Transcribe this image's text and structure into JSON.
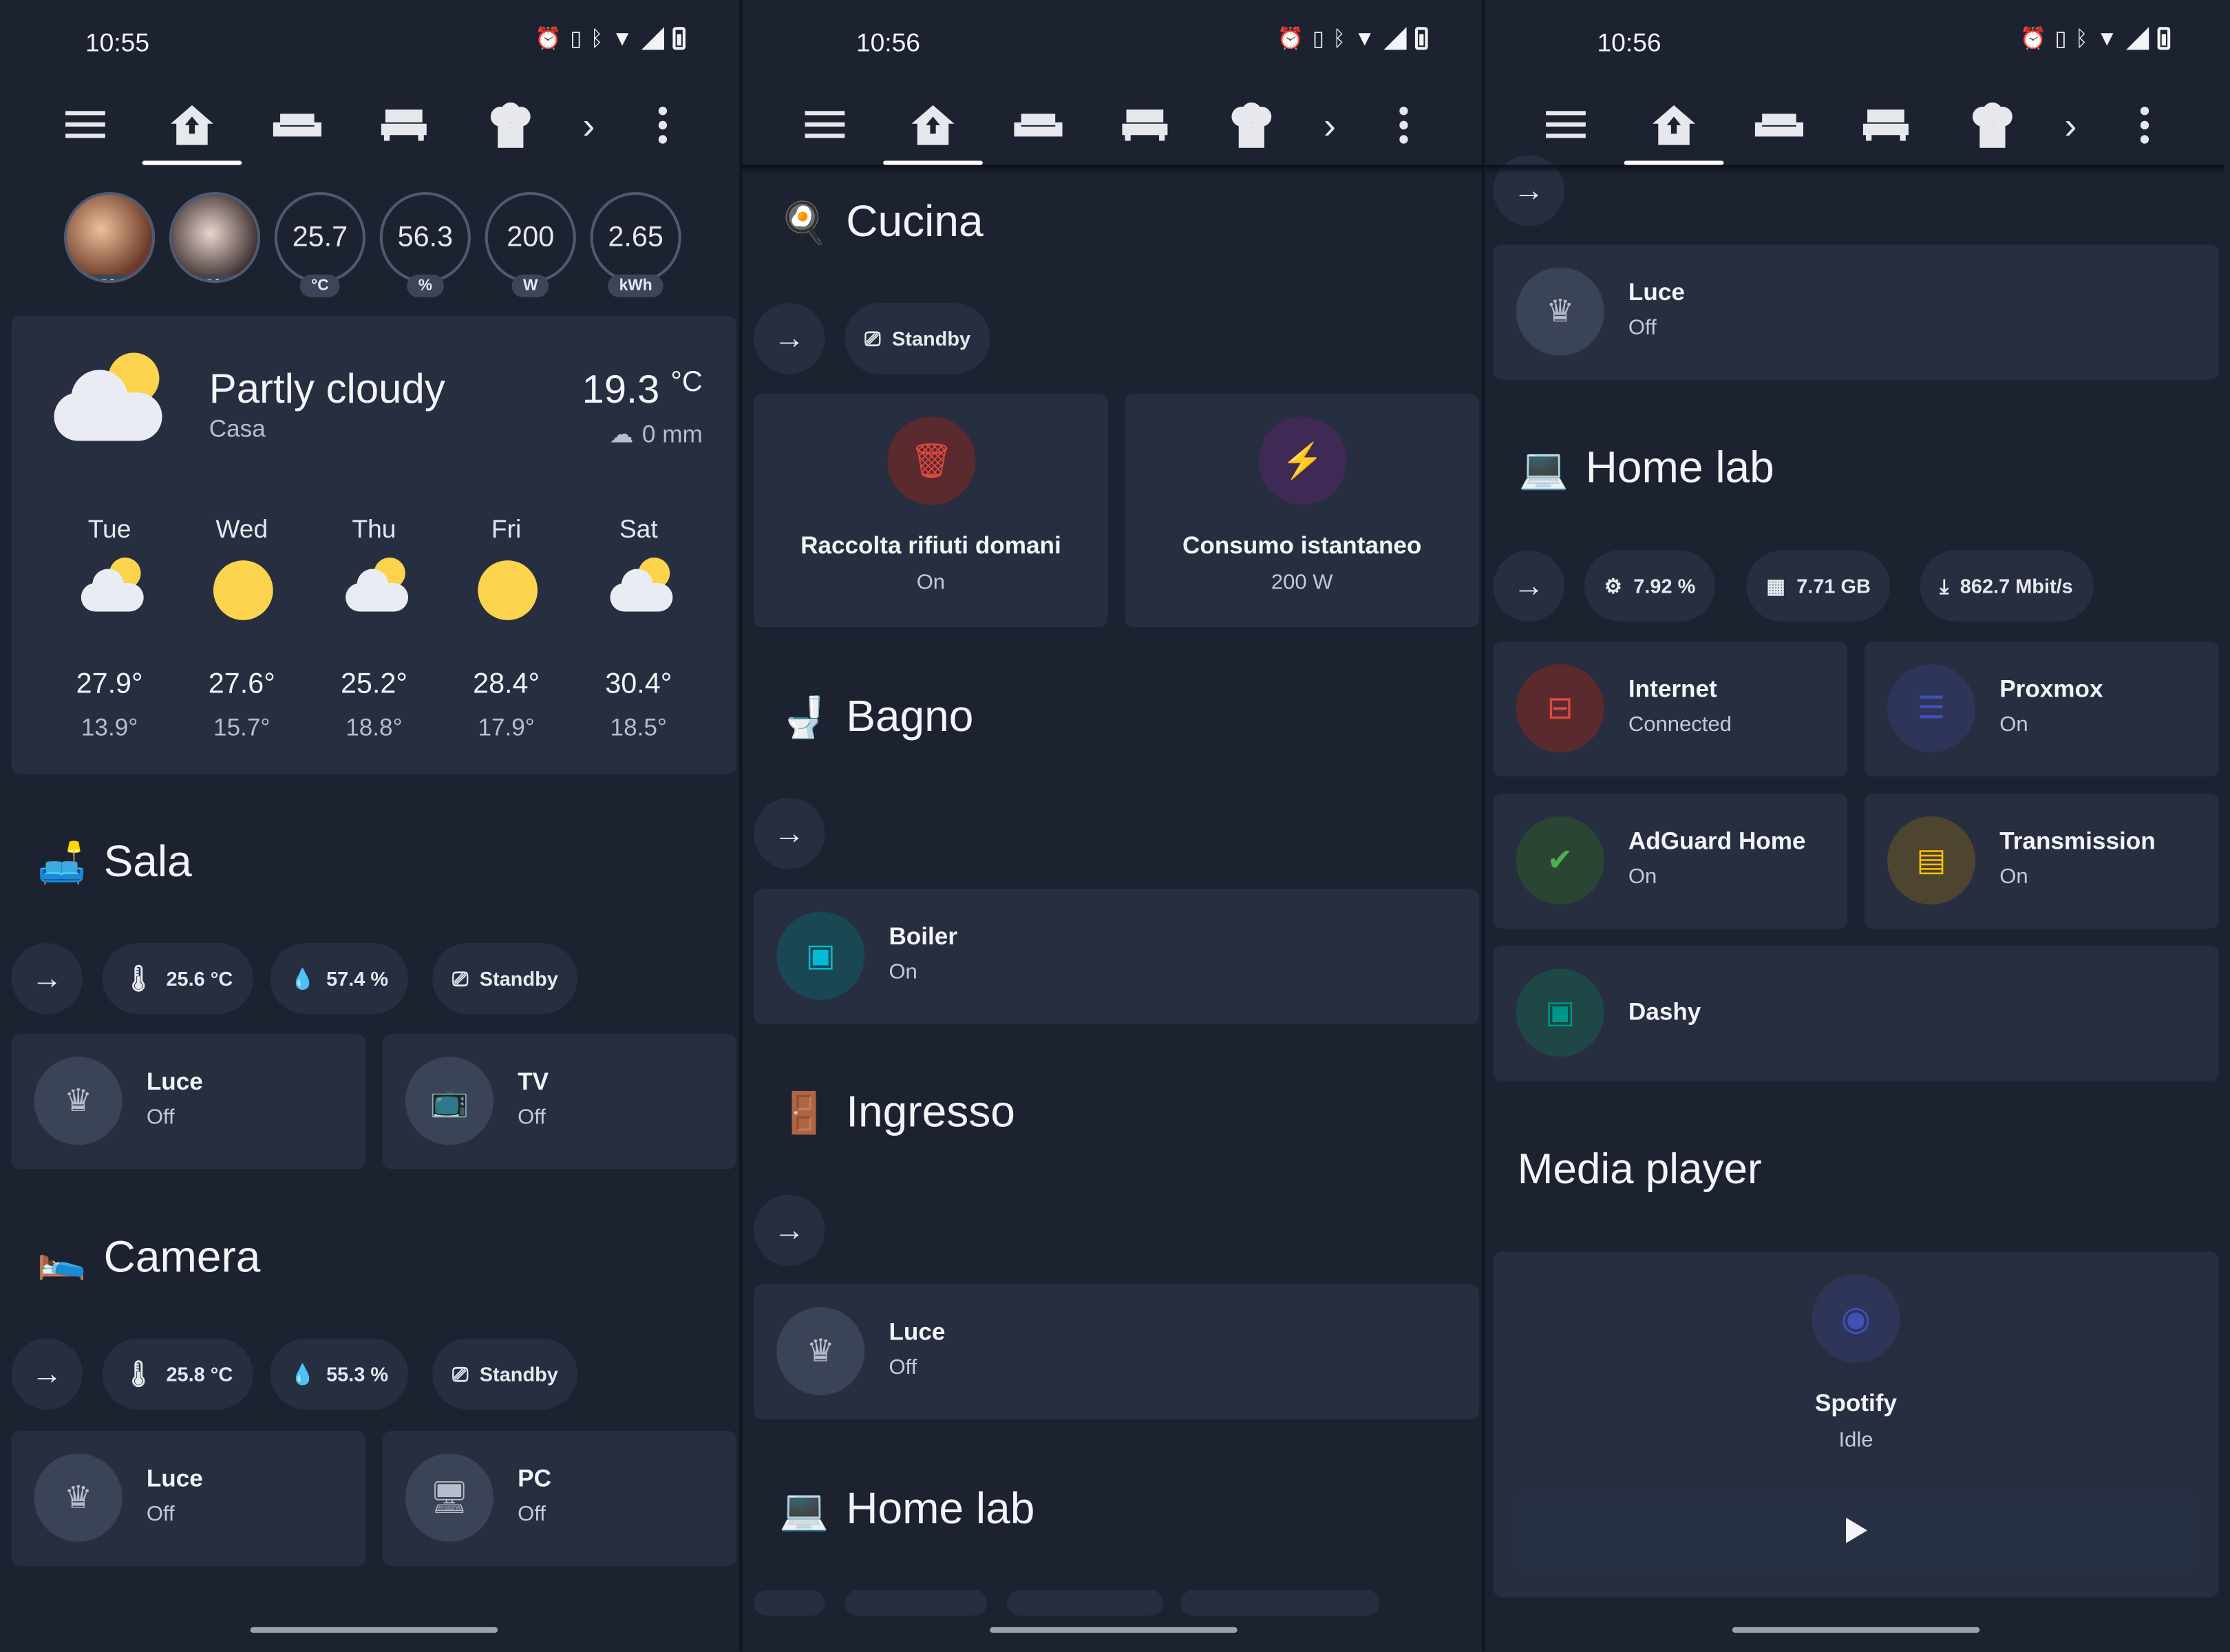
{
  "panels": [
    {
      "time": "10:55"
    },
    {
      "time": "10:56"
    },
    {
      "time": "10:56"
    }
  ],
  "status_icons": [
    "alarm-icon",
    "vibrate-icon",
    "bluetooth-icon",
    "wifi-icon",
    "signal-icon",
    "battery-icon"
  ],
  "toolbar": {
    "icons": [
      "menu-icon",
      "home-automation-icon",
      "sofa-icon",
      "bed-icon",
      "chef-hat-icon",
      "chevron-right-icon",
      "more-vertical-icon"
    ]
  },
  "badges": [
    {
      "value": "",
      "label": "HOME"
    },
    {
      "value": "",
      "label": "HOME"
    },
    {
      "value": "25.7",
      "label": "°C"
    },
    {
      "value": "56.3",
      "label": "%"
    },
    {
      "value": "200",
      "label": "W"
    },
    {
      "value": "2.65",
      "label": "kWh"
    }
  ],
  "weather": {
    "condition": "Partly cloudy",
    "location": "Casa",
    "temperature": "19.3",
    "unit": "°C",
    "precipitation": "0 mm",
    "forecast": [
      {
        "day": "Tue",
        "high": "27.9°",
        "low": "13.9°",
        "icon": "partly-cloudy"
      },
      {
        "day": "Wed",
        "high": "27.6°",
        "low": "15.7°",
        "icon": "sunny"
      },
      {
        "day": "Thu",
        "high": "25.2°",
        "low": "18.8°",
        "icon": "partly-cloudy"
      },
      {
        "day": "Fri",
        "high": "28.4°",
        "low": "17.9°",
        "icon": "sunny"
      },
      {
        "day": "Sat",
        "high": "30.4°",
        "low": "18.5°",
        "icon": "partly-cloudy"
      }
    ]
  },
  "sala": {
    "title": "Sala",
    "emoji": "🛋️",
    "chips": {
      "temp": "25.6 °C",
      "humidity": "57.4 %",
      "media": "Standby"
    },
    "tiles": [
      {
        "name": "Luce",
        "state": "Off"
      },
      {
        "name": "TV",
        "state": "Off"
      }
    ]
  },
  "camera": {
    "title": "Camera",
    "emoji": "🛌",
    "chips": {
      "temp": "25.8 °C",
      "humidity": "55.3 %",
      "media": "Standby"
    },
    "tiles": [
      {
        "name": "Luce",
        "state": "Off"
      },
      {
        "name": "PC",
        "state": "Off"
      }
    ]
  },
  "cucina": {
    "title": "Cucina",
    "emoji": "🍳",
    "chips": {
      "media": "Standby"
    },
    "tiles": [
      {
        "name": "Raccolta rifiuti domani",
        "state": "On"
      },
      {
        "name": "Consumo istantaneo",
        "state": "200 W"
      }
    ]
  },
  "bagno": {
    "title": "Bagno",
    "emoji": "🚽",
    "tiles": [
      {
        "name": "Boiler",
        "state": "On"
      }
    ]
  },
  "ingresso": {
    "title": "Ingresso",
    "emoji": "🚪",
    "tiles": [
      {
        "name": "Luce",
        "state": "Off"
      }
    ]
  },
  "homelab": {
    "title": "Home lab",
    "emoji": "💻",
    "chips": {
      "cpu": "7.92 %",
      "memory": "7.71 GB",
      "download": "862.7 Mbit/s"
    },
    "tiles": [
      {
        "name": "Internet",
        "state": "Connected"
      },
      {
        "name": "Proxmox",
        "state": "On"
      },
      {
        "name": "AdGuard Home",
        "state": "On"
      },
      {
        "name": "Transmission",
        "state": "On"
      },
      {
        "name": "Dashy",
        "state": ""
      }
    ]
  },
  "p3_top_tile": {
    "name": "Luce",
    "state": "Off"
  },
  "media_player": {
    "title": "Media player",
    "name": "Spotify",
    "state": "Idle"
  },
  "colors": {
    "background": "#1c2230",
    "card": "#262e3f",
    "trash_red": "#e0483e",
    "energy_purple": "#9c27b0",
    "boiler_cyan": "#00bcd4",
    "adguard_green": "#4caf50",
    "transmission_amber": "#ffc107",
    "dashy_teal": "#009688",
    "proxmox_indigo": "#3f51b5",
    "spotify_blue": "#3f51b5"
  }
}
